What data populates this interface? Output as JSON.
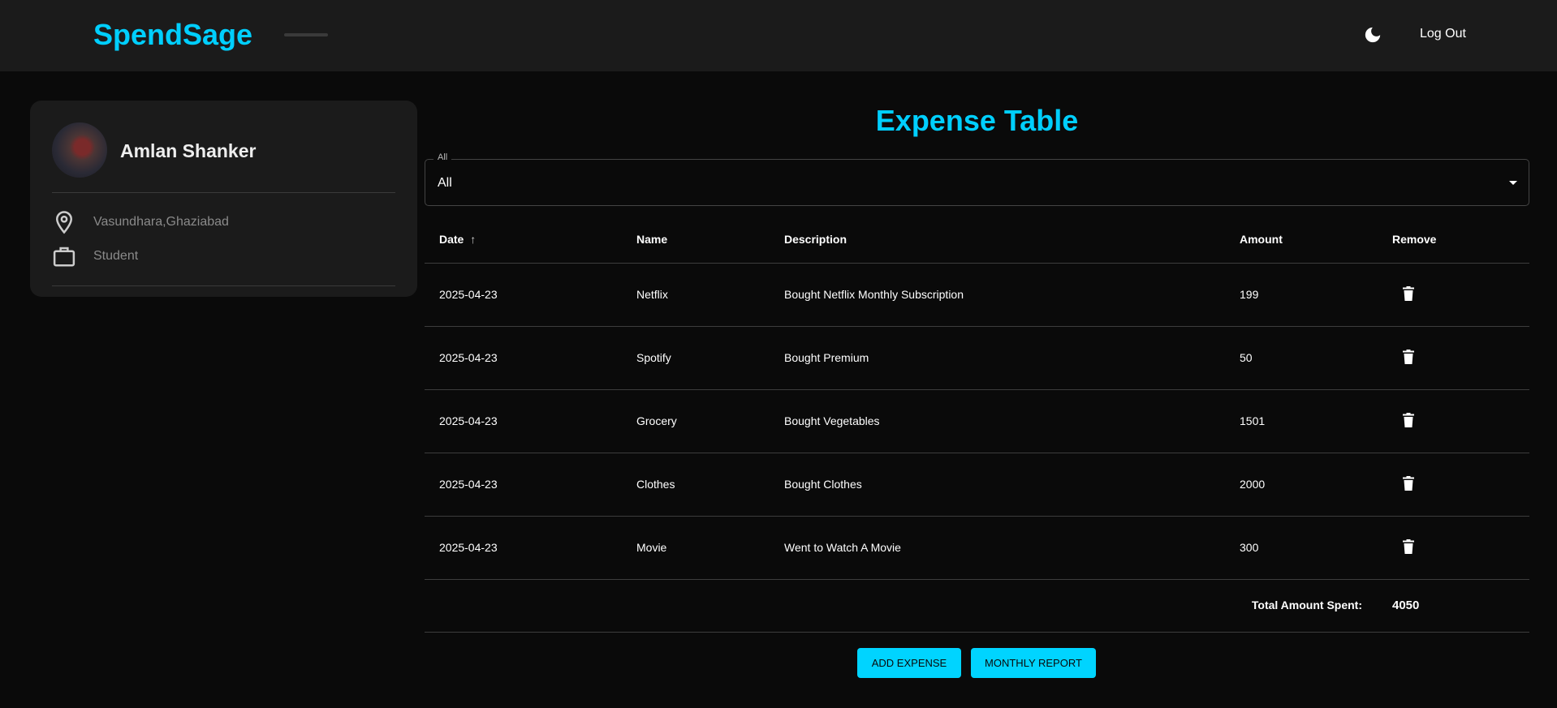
{
  "header": {
    "logo": "SpendSage",
    "theme_icon": "moon-icon",
    "logout_label": "Log Out"
  },
  "profile": {
    "name": "Amlan Shanker",
    "location": "Vasundhara,Ghaziabad",
    "occupation": "Student"
  },
  "main": {
    "title": "Expense Table",
    "filter": {
      "label": "All",
      "value": "All"
    },
    "columns": [
      "Date",
      "Name",
      "Description",
      "Amount",
      "Remove"
    ],
    "rows": [
      {
        "date": "2025-04-23",
        "name": "Netflix",
        "description": "Bought Netflix Monthly Subscription",
        "amount": "199"
      },
      {
        "date": "2025-04-23",
        "name": "Spotify",
        "description": "Bought Premium",
        "amount": "50"
      },
      {
        "date": "2025-04-23",
        "name": "Grocery",
        "description": "Bought Vegetables",
        "amount": "1501"
      },
      {
        "date": "2025-04-23",
        "name": "Clothes",
        "description": "Bought Clothes",
        "amount": "2000"
      },
      {
        "date": "2025-04-23",
        "name": "Movie",
        "description": "Went to Watch A Movie",
        "amount": "300"
      }
    ],
    "total_label": "Total Amount Spent:",
    "total_value": "4050",
    "add_label": "Add Expense",
    "report_label": "Monthly Report"
  },
  "colors": {
    "accent": "#00cfff",
    "background": "#0a0a0a",
    "header": "#1b1b1b"
  }
}
